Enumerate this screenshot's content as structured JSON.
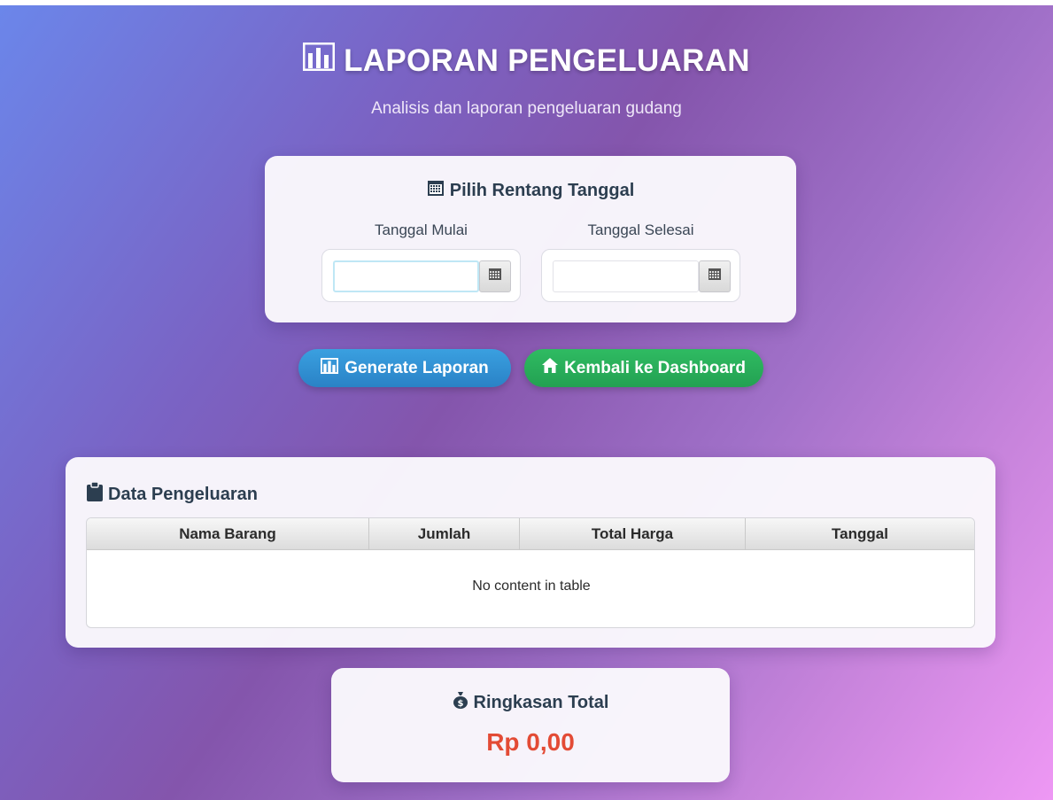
{
  "header": {
    "title": "LAPORAN PENGELUARAN",
    "subtitle": "Analisis dan laporan pengeluaran gudang",
    "title_icon": "bar-chart-icon"
  },
  "date_range": {
    "title": "Pilih Rentang Tanggal",
    "title_icon": "calendar-icon",
    "start_label": "Tanggal Mulai",
    "start_value": "",
    "end_label": "Tanggal Selesai",
    "end_value": ""
  },
  "actions": {
    "generate_label": "Generate Laporan",
    "generate_icon": "bar-chart-icon",
    "back_label": "Kembali ke Dashboard",
    "back_icon": "home-icon",
    "generate_color": "#2f8fd3",
    "back_color": "#27ae60"
  },
  "table": {
    "title": "Data Pengeluaran",
    "title_icon": "clipboard-icon",
    "columns": [
      "Nama Barang",
      "Jumlah",
      "Total Harga",
      "Tanggal"
    ],
    "rows": [],
    "empty_message": "No content in table"
  },
  "summary": {
    "title": "Ringkasan Total",
    "title_icon": "money-bag-icon",
    "value": "Rp 0,00",
    "value_color": "#e34b35"
  }
}
